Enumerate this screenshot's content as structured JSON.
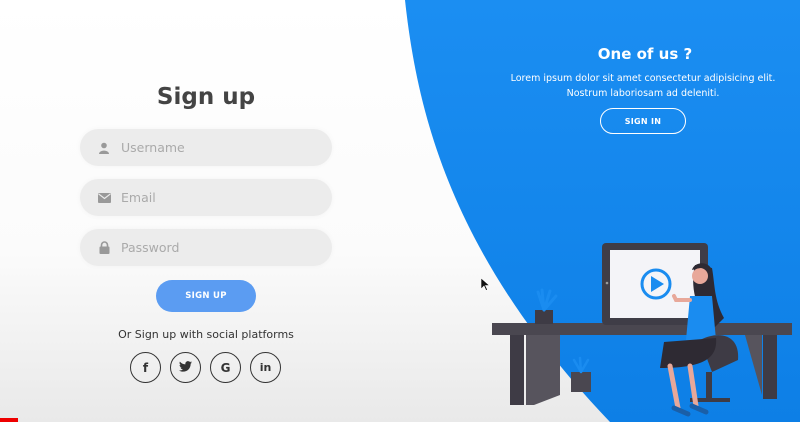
{
  "colors": {
    "accent": "#1a8cf0",
    "button": "#5b9cf2",
    "field_bg": "#ececec"
  },
  "signup": {
    "title": "Sign up",
    "username_placeholder": "Username",
    "email_placeholder": "Email",
    "password_placeholder": "Password",
    "button_label": "SIGN UP",
    "social_text": "Or Sign up with social platforms",
    "social": [
      {
        "label": "f",
        "icon": "facebook-icon"
      },
      {
        "label": "",
        "icon": "twitter-icon"
      },
      {
        "label": "G",
        "icon": "google-icon"
      },
      {
        "label": "in",
        "icon": "linkedin-icon"
      }
    ]
  },
  "panel": {
    "title": "One of us ?",
    "text_line1": "Lorem ipsum dolor sit amet consectetur adipisicing elit.",
    "text_line2": "Nostrum laboriosam ad deleniti.",
    "button_label": "SIGN IN"
  }
}
